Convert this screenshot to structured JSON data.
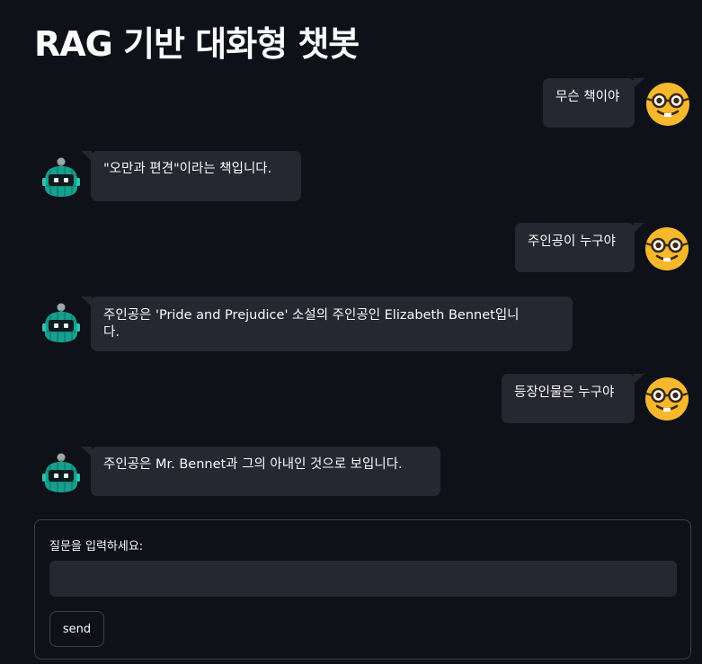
{
  "header": {
    "title": "RAG 기반 대화형 챗봇"
  },
  "messages": [
    {
      "role": "user",
      "text": "무슨 책이야"
    },
    {
      "role": "bot",
      "text": "\"오만과 편견\"이라는 책입니다."
    },
    {
      "role": "user",
      "text": "주인공이 누구야"
    },
    {
      "role": "bot",
      "line1": "주인공은 'Pride and Prejudice' 소설의 주인공인 Elizabeth Bennet입니",
      "line2": "다."
    },
    {
      "role": "user",
      "text": "등장인물은 누구야"
    },
    {
      "role": "bot",
      "text": "주인공은 Mr. Bennet과 그의 아내인 것으로 보입니다."
    }
  ],
  "avatars": {
    "user": "nerd-face-emoji-icon",
    "bot": "robot-avatar-icon"
  },
  "form": {
    "label": "질문을 입력하세요:",
    "input_value": "",
    "send_label": "send"
  },
  "colors": {
    "background": "#0e1117",
    "bubble": "#262730",
    "user_avatar": "#f7b82d",
    "bot_avatar": "#1aa89a"
  }
}
